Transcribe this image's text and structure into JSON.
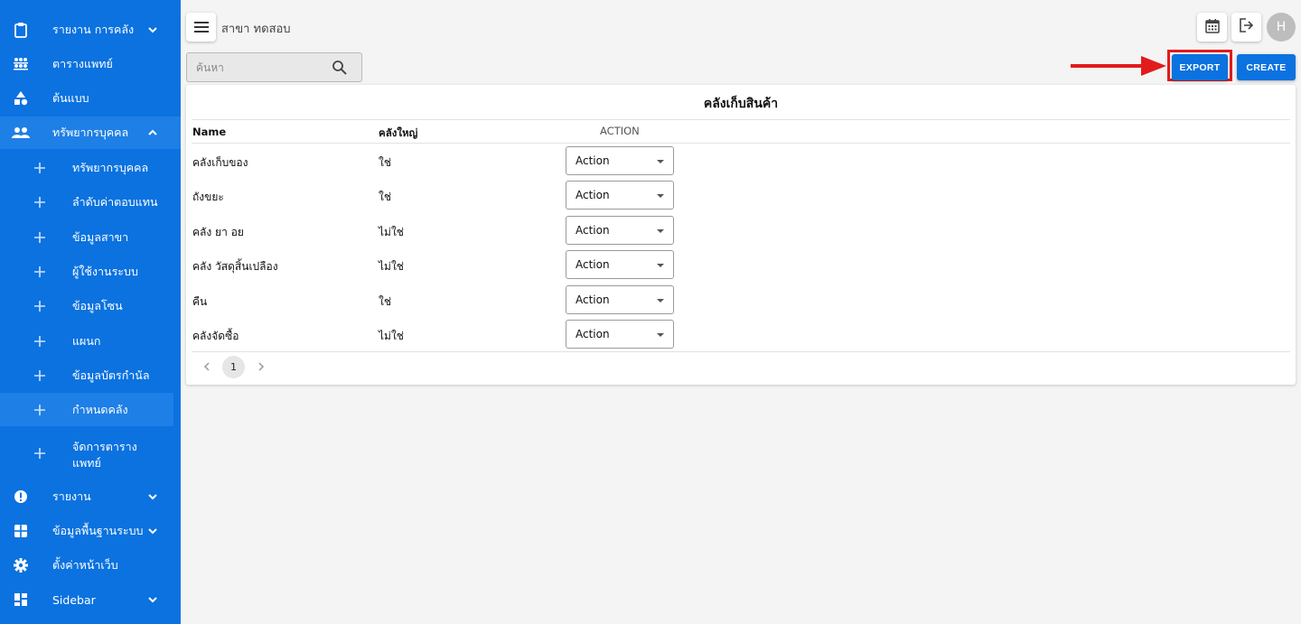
{
  "sidebar": {
    "items": [
      {
        "label": "รายงาน การคลัง",
        "icon": "clipboard-icon",
        "has_chevron": true,
        "chevron": "down"
      },
      {
        "label": "ตารางแพทย์",
        "icon": "people-grid-icon"
      },
      {
        "label": "ต้นแบบ",
        "icon": "shapes-icon"
      },
      {
        "label": "ทรัพยากรบุคคล",
        "icon": "people-icon",
        "has_chevron": true,
        "chevron": "up",
        "expanded": true
      },
      {
        "label": "รายงาน",
        "icon": "alert-circle-icon",
        "has_chevron": true,
        "chevron": "down"
      },
      {
        "label": "ข้อมูลพื้นฐานระบบ",
        "icon": "grid-icon",
        "has_chevron": true,
        "chevron": "down"
      },
      {
        "label": "ตั้งค่าหน้าเว็บ",
        "icon": "gear-icon"
      },
      {
        "label": "Sidebar",
        "icon": "dashboard-icon",
        "has_chevron": true,
        "chevron": "down"
      }
    ],
    "sub_items": [
      {
        "label": "ทรัพยากรบุคคล"
      },
      {
        "label": "ลำดับค่าตอบแทน"
      },
      {
        "label": "ข้อมูลสาขา"
      },
      {
        "label": "ผู้ใช้งานระบบ"
      },
      {
        "label": "ข้อมูลโซน"
      },
      {
        "label": "แผนก"
      },
      {
        "label": "ข้อมูลบัตรกำนัล"
      },
      {
        "label": "กำหนดคลัง",
        "active": true
      },
      {
        "label": "จัดการตาราง",
        "label2": "แพทย์"
      }
    ]
  },
  "topbar": {
    "branch": "สาขา ทดสอบ",
    "avatar_letter": "H"
  },
  "search": {
    "placeholder": "ค้นหา"
  },
  "buttons": {
    "export": "EXPORT",
    "create": "CREATE"
  },
  "table": {
    "title": "คลังเก็บสินค้า",
    "headers": {
      "name": "Name",
      "main": "คลังใหญ่",
      "action": "ACTION"
    },
    "rows": [
      {
        "name": "คลังเก็บของ",
        "main": "ใช่",
        "action": "Action"
      },
      {
        "name": "ถังขยะ",
        "main": "ใช่",
        "action": "Action"
      },
      {
        "name": "คลัง ยา อย",
        "main": "ไม่ใช่",
        "action": "Action"
      },
      {
        "name": "คลัง วัสดุสิ้นเปลือง",
        "main": "ไม่ใช่",
        "action": "Action"
      },
      {
        "name": "คืน",
        "main": "ใช่",
        "action": "Action"
      },
      {
        "name": "คลังจัดซื้อ",
        "main": "ไม่ใช่",
        "action": "Action"
      }
    ],
    "pagination": {
      "current_page": "1"
    }
  },
  "colors": {
    "sidebar": "#0b72e0",
    "accent": "#0b72e0",
    "highlight": "#e11b1b"
  }
}
